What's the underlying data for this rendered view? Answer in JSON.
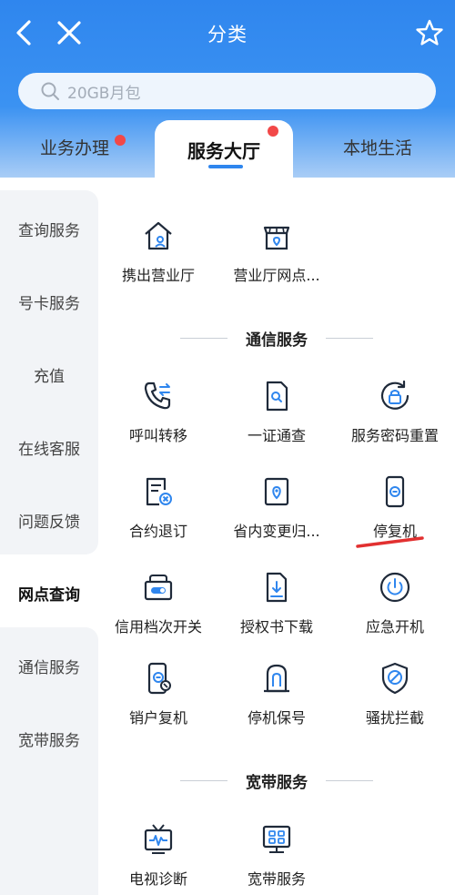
{
  "header": {
    "title": "分类",
    "back_icon": "back-chevron-icon",
    "close_icon": "close-icon",
    "favorite_icon": "star-icon"
  },
  "search": {
    "placeholder": "20GB月包",
    "icon": "search-icon"
  },
  "tabs": [
    {
      "label": "业务办理",
      "has_dot": true
    },
    {
      "label": "服务大厅",
      "has_dot": true,
      "active": true
    },
    {
      "label": "本地生活",
      "has_dot": false
    }
  ],
  "sidebar": {
    "items": [
      {
        "label": "查询服务"
      },
      {
        "label": "号卡服务"
      },
      {
        "label": "充值"
      },
      {
        "label": "在线客服"
      },
      {
        "label": "问题反馈"
      },
      {
        "label": "网点查询",
        "active": true
      },
      {
        "label": "通信服务"
      },
      {
        "label": "宽带服务"
      }
    ]
  },
  "main": {
    "outlets": [
      {
        "label": "携出营业厅",
        "icon": "house-transfer-icon"
      },
      {
        "label": "营业厅网点...",
        "icon": "storefront-location-icon"
      }
    ],
    "telecom_section": {
      "title": "通信服务",
      "items": [
        {
          "label": "呼叫转移",
          "icon": "call-forward-icon"
        },
        {
          "label": "一证通查",
          "icon": "id-search-icon"
        },
        {
          "label": "服务密码重置",
          "icon": "password-reset-icon"
        },
        {
          "label": "合约退订",
          "icon": "contract-cancel-icon"
        },
        {
          "label": "省内变更归...",
          "icon": "location-change-icon"
        },
        {
          "label": "停复机",
          "icon": "phone-suspend-icon"
        },
        {
          "label": "信用档次开关",
          "icon": "credit-toggle-icon"
        },
        {
          "label": "授权书下载",
          "icon": "document-download-icon"
        },
        {
          "label": "应急开机",
          "icon": "power-icon"
        },
        {
          "label": "销户复机",
          "icon": "account-restore-icon"
        },
        {
          "label": "停机保号",
          "icon": "number-keep-icon"
        },
        {
          "label": "骚扰拦截",
          "icon": "shield-block-icon"
        }
      ]
    },
    "broadband_section": {
      "title": "宽带服务",
      "items": [
        {
          "label": "电视诊断",
          "icon": "tv-diagnose-icon"
        },
        {
          "label": "宽带服务",
          "icon": "router-icon"
        }
      ]
    }
  },
  "colors": {
    "brand_blue": "#2f86ee",
    "icon_stroke": "#1f2a3a",
    "icon_accent": "#2f86ee",
    "badge_red": "#f24848",
    "annotation_red": "#e23030"
  }
}
